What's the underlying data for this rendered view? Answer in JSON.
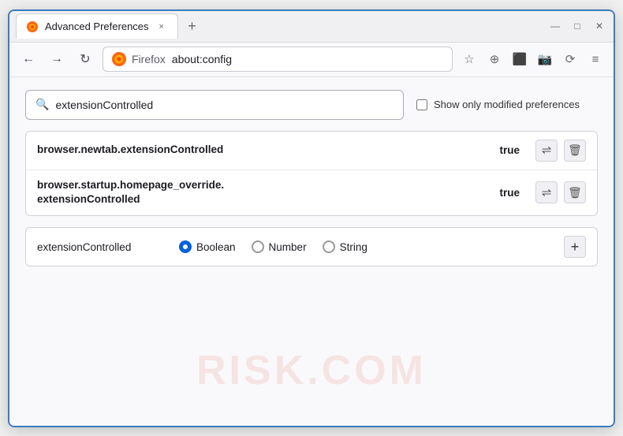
{
  "window": {
    "title": "Advanced Preferences",
    "tab_close": "×",
    "new_tab": "+",
    "win_minimize": "—",
    "win_restore": "□",
    "win_close": "✕"
  },
  "navbar": {
    "back": "←",
    "forward": "→",
    "refresh": "↻",
    "site_name": "Firefox",
    "address": "about:config",
    "bookmark_icon": "☆",
    "shield_icon": "⊕",
    "extensions_icon": "⬛",
    "camera_icon": "📷",
    "sync_icon": "⟳",
    "menu_icon": "≡"
  },
  "search": {
    "placeholder": "extensionControlled",
    "value": "extensionControlled",
    "checkbox_label": "Show only modified preferences"
  },
  "prefs": [
    {
      "name": "browser.newtab.extensionControlled",
      "value": "true"
    },
    {
      "name_line1": "browser.startup.homepage_override.",
      "name_line2": "extensionControlled",
      "value": "true"
    }
  ],
  "add_row": {
    "name": "extensionControlled",
    "type_boolean": "Boolean",
    "type_number": "Number",
    "type_string": "String"
  },
  "watermark": "RISK.COM"
}
